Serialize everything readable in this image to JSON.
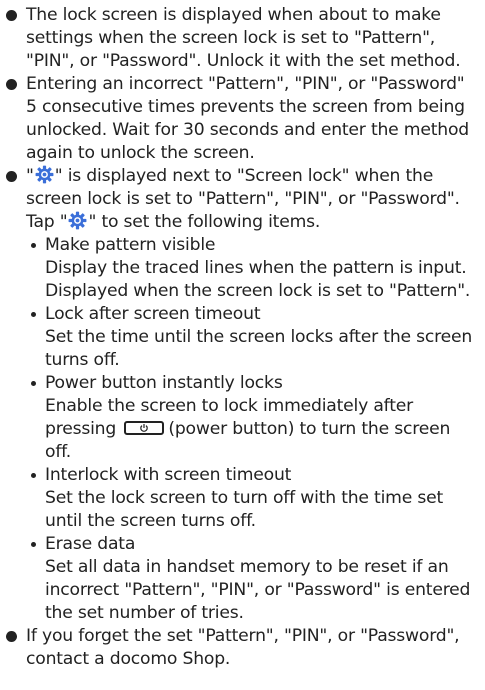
{
  "bullets": {
    "b1": "The lock screen is displayed when about to make settings when the screen lock is set to \"Pattern\", \"PIN\", or \"Password\". Unlock it with the set method.",
    "b2": "Entering an incorrect \"Pattern\", \"PIN\", or \"Password\" 5 consecutive times prevents the screen from being unlocked. Wait for 30 seconds and enter the method again to unlock the screen.",
    "b3_part1": "\"",
    "b3_part2": "\" is displayed next to \"Screen lock\" when the screen lock is set to \"Pattern\", \"PIN\", or \"Password\". Tap \"",
    "b3_part3": "\" to set the following items.",
    "b4": "If you forget the set \"Pattern\", \"PIN\", or \"Password\", contact a docomo Shop."
  },
  "items": [
    {
      "title": "Make pattern visible",
      "desc": "Display the traced lines when the pattern is input. Displayed when the screen lock is set to \"Pattern\"."
    },
    {
      "title": "Lock after screen timeout",
      "desc": "Set the time until the screen locks after the screen turns off."
    },
    {
      "title": "Power button instantly locks",
      "desc_before": "Enable the screen to lock immediately after pressing",
      "desc_after": "(power button) to turn the screen off."
    },
    {
      "title": "Interlock with screen timeout",
      "desc": "Set the lock screen to turn off with the time set until the screen turns off."
    },
    {
      "title": "Erase data",
      "desc": "Set all data in handset memory to be reset if an incorrect \"Pattern\", \"PIN\", or \"Password\" is entered the set number of tries."
    }
  ],
  "icons": {
    "settings": "settings-gear-icon",
    "power": "power-button-icon"
  },
  "colors": {
    "text": "#222222",
    "gear_fill": "#3b6fd9"
  }
}
